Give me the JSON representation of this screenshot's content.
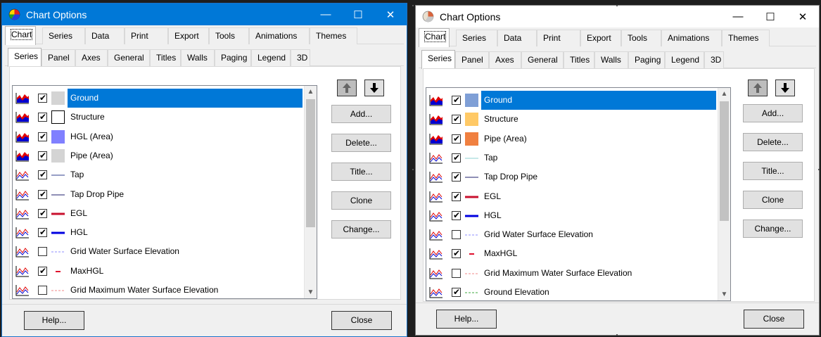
{
  "windows": [
    {
      "title": "Chart Options",
      "controls": {
        "minimize": "—",
        "maximize": "☐",
        "close": "✕"
      },
      "main_tabs": [
        "Chart",
        "Series",
        "Data",
        "Print",
        "Export",
        "Tools",
        "Animations",
        "Themes"
      ],
      "sub_tabs": [
        "Series",
        "Panel",
        "Axes",
        "General",
        "Titles",
        "Walls",
        "Paging",
        "Legend",
        "3D"
      ],
      "series": [
        {
          "label": "Ground",
          "checked": true,
          "selected": true,
          "icon": "area-chart-icon",
          "swatch": "fill",
          "color": "#d4d4d4"
        },
        {
          "label": "Structure",
          "checked": true,
          "icon": "area-chart-icon",
          "swatch": "fill",
          "color": "#ffffff"
        },
        {
          "label": "HGL (Area)",
          "checked": true,
          "icon": "area-chart-icon",
          "swatch": "fill",
          "color": "#8080ff"
        },
        {
          "label": "Pipe (Area)",
          "checked": true,
          "icon": "area-chart-icon",
          "swatch": "fill",
          "color": "#d4d4d4"
        },
        {
          "label": "Tap",
          "checked": true,
          "icon": "line-chart-icon",
          "swatch": "line",
          "color": "#2f3e8c",
          "width": 1
        },
        {
          "label": "Tap Drop Pipe",
          "checked": true,
          "icon": "line-chart-icon",
          "swatch": "line",
          "color": "#1f1f6e",
          "width": 1
        },
        {
          "label": "EGL",
          "checked": true,
          "icon": "line-chart-icon",
          "swatch": "line",
          "color": "#c8102e",
          "width": 3
        },
        {
          "label": "HGL",
          "checked": true,
          "icon": "line-chart-icon",
          "swatch": "line",
          "color": "#0000e0",
          "width": 3
        },
        {
          "label": "Grid Water Surface Elevation",
          "checked": false,
          "icon": "line-chart-icon",
          "swatch": "dash",
          "color": "#8f8fff",
          "width": 1
        },
        {
          "label": "MaxHGL",
          "checked": true,
          "icon": "line-chart-icon",
          "swatch": "line",
          "color": "#e0102e",
          "width": 2
        },
        {
          "label": "Grid Maximum Water Surface Elevation",
          "checked": false,
          "icon": "line-chart-icon",
          "swatch": "dash",
          "color": "#f08a8a",
          "width": 1
        }
      ],
      "side_buttons": {
        "add": "Add...",
        "delete": "Delete...",
        "title": "Title...",
        "clone": "Clone",
        "change": "Change..."
      },
      "footer": {
        "help": "Help...",
        "close": "Close"
      }
    },
    {
      "title": "Chart Options",
      "controls": {
        "minimize": "—",
        "maximize": "☐",
        "close": "✕"
      },
      "main_tabs": [
        "Chart",
        "Series",
        "Data",
        "Print",
        "Export",
        "Tools",
        "Animations",
        "Themes"
      ],
      "sub_tabs": [
        "Series",
        "Panel",
        "Axes",
        "General",
        "Titles",
        "Walls",
        "Paging",
        "Legend",
        "3D"
      ],
      "series": [
        {
          "label": "Ground",
          "checked": true,
          "selected": true,
          "icon": "area-chart-icon",
          "swatch": "fill",
          "color": "#7f9fd6"
        },
        {
          "label": "Structure",
          "checked": true,
          "icon": "area-chart-icon",
          "swatch": "fill",
          "color": "#ffc966"
        },
        {
          "label": "Pipe (Area)",
          "checked": true,
          "icon": "area-chart-icon",
          "swatch": "fill",
          "color": "#f08040"
        },
        {
          "label": "Tap",
          "checked": true,
          "icon": "line-chart-icon",
          "swatch": "line",
          "color": "#8fd0d0",
          "width": 1
        },
        {
          "label": "Tap Drop Pipe",
          "checked": true,
          "icon": "line-chart-icon",
          "swatch": "line",
          "color": "#1f1f6e",
          "width": 1
        },
        {
          "label": "EGL",
          "checked": true,
          "icon": "line-chart-icon",
          "swatch": "line",
          "color": "#c8102e",
          "width": 3
        },
        {
          "label": "HGL",
          "checked": true,
          "icon": "line-chart-icon",
          "swatch": "line",
          "color": "#0000e0",
          "width": 3
        },
        {
          "label": "Grid Water Surface Elevation",
          "checked": false,
          "icon": "line-chart-icon",
          "swatch": "dash",
          "color": "#8f8fff",
          "width": 1
        },
        {
          "label": "MaxHGL",
          "checked": true,
          "icon": "line-chart-icon",
          "swatch": "line",
          "color": "#e0102e",
          "width": 2
        },
        {
          "label": "Grid Maximum Water Surface Elevation",
          "checked": false,
          "icon": "line-chart-icon",
          "swatch": "dash",
          "color": "#f08a8a",
          "width": 1
        },
        {
          "label": "Ground Elevation",
          "checked": true,
          "icon": "line-chart-icon",
          "swatch": "dash",
          "color": "#3fa83f",
          "width": 1
        }
      ],
      "side_buttons": {
        "add": "Add...",
        "delete": "Delete...",
        "title": "Title...",
        "clone": "Clone",
        "change": "Change..."
      },
      "footer": {
        "help": "Help...",
        "close": "Close"
      }
    }
  ]
}
